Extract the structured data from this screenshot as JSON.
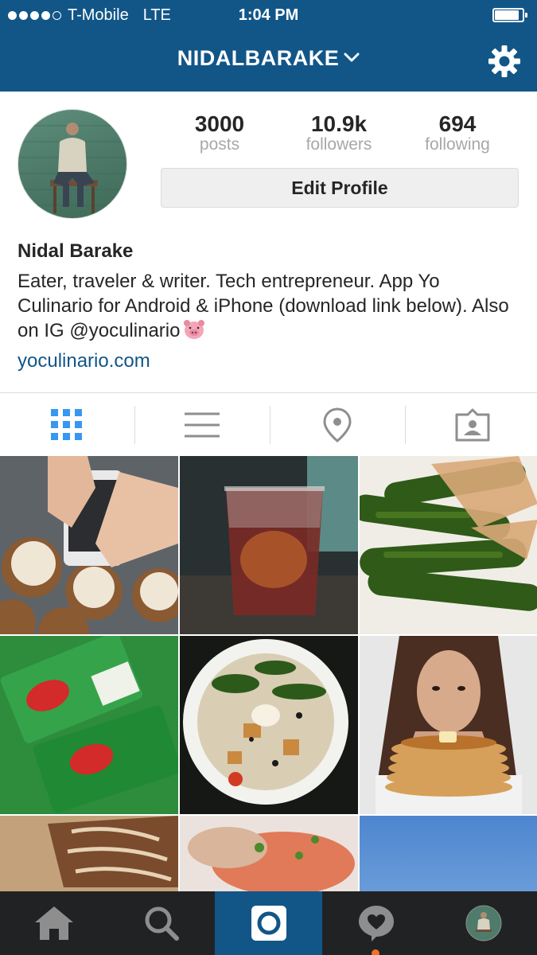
{
  "status_bar": {
    "carrier": "T-Mobile",
    "network": "LTE",
    "time": "1:04 PM",
    "signal_bars": 4
  },
  "nav": {
    "username": "NIDALBARAKE",
    "settings_icon": "gear-icon"
  },
  "profile": {
    "stats": [
      {
        "value": "3000",
        "label": "posts"
      },
      {
        "value": "10.9k",
        "label": "followers"
      },
      {
        "value": "694",
        "label": "following"
      }
    ],
    "edit_label": "Edit Profile",
    "name": "Nidal Barake",
    "bio": "Eater, traveler & writer. Tech entrepreneur. App Yo Culinario for Android & iPhone (download link below). Also on IG @yoculinario",
    "website": "yoculinario.com"
  },
  "tabs": [
    {
      "icon": "grid-icon",
      "active": true
    },
    {
      "icon": "list-icon",
      "active": false
    },
    {
      "icon": "location-pin-icon",
      "active": false
    },
    {
      "icon": "tagged-person-icon",
      "active": false
    }
  ],
  "bottom_nav": [
    {
      "icon": "home-icon",
      "active": false
    },
    {
      "icon": "search-icon",
      "active": false
    },
    {
      "icon": "camera-icon",
      "active": true
    },
    {
      "icon": "activity-heart-icon",
      "active": false
    },
    {
      "icon": "profile-avatar",
      "active": false
    }
  ],
  "colors": {
    "brand": "#125688",
    "bottom_bar": "#202224",
    "active_tab": "#3897f0",
    "notification": "#f37121"
  }
}
